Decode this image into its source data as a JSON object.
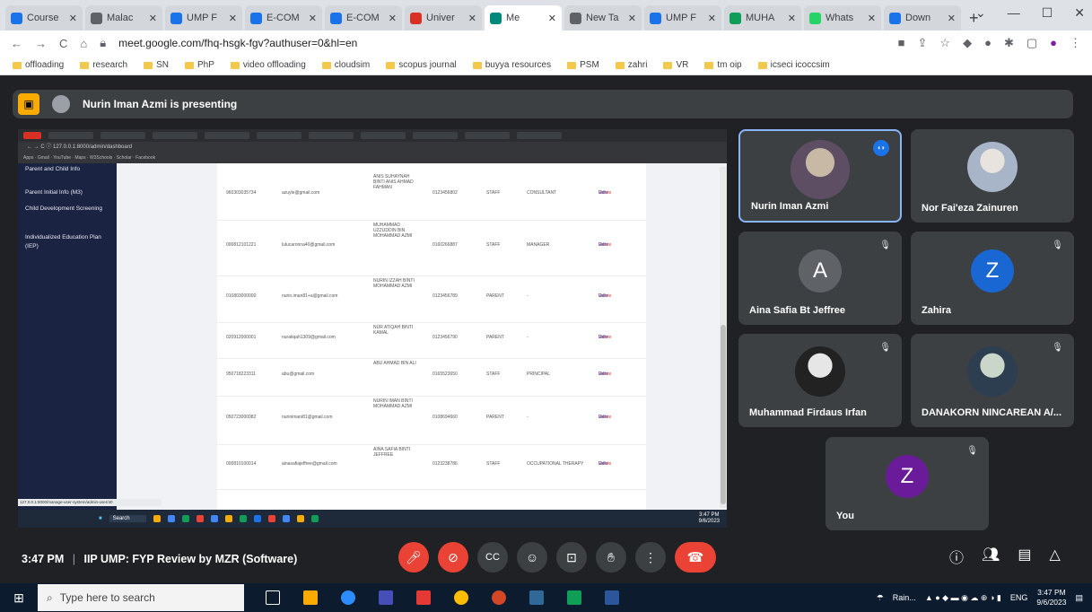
{
  "browser": {
    "tabs": [
      {
        "label": "Course",
        "icon": "ump-icon",
        "color": "#1a73e8"
      },
      {
        "label": "Malac",
        "icon": "chrome-icon",
        "color": "#5f6368"
      },
      {
        "label": "UMP F",
        "icon": "ump-icon",
        "color": "#1a73e8"
      },
      {
        "label": "E-COM",
        "icon": "ump-icon",
        "color": "#1a73e8"
      },
      {
        "label": "E-COM",
        "icon": "ump-icon",
        "color": "#1a73e8"
      },
      {
        "label": "Univer",
        "icon": "gmail-icon",
        "color": "#d93025"
      },
      {
        "label": "Me",
        "icon": "meet-icon",
        "color": "#00897b",
        "active": true
      },
      {
        "label": "New Ta",
        "icon": "chrome-icon",
        "color": "#5f6368"
      },
      {
        "label": "UMP F",
        "icon": "ump-icon",
        "color": "#1a73e8"
      },
      {
        "label": "MUHA",
        "icon": "drive-icon",
        "color": "#0f9d58"
      },
      {
        "label": "Whats",
        "icon": "whatsapp-icon",
        "color": "#25d366"
      },
      {
        "label": "Down",
        "icon": "download-icon",
        "color": "#1a73e8"
      }
    ],
    "new_tab": "+",
    "url": "meet.google.com/fhq-hsgk-fgv?authuser=0&hl=en",
    "bookmarks": [
      "offloading",
      "research",
      "SN",
      "PhP",
      "video offloading",
      "cloudsim",
      "scopus journal",
      "buyya resources",
      "PSM",
      "zahri",
      "VR",
      "tm oip",
      "icseci icoccsim"
    ]
  },
  "meet": {
    "presenting_text": "Nurin Iman Azmi is presenting",
    "time": "3:47 PM",
    "divider": "|",
    "meeting_title": "IIP UMP: FYP Review by MZR (Software)"
  },
  "shared_screen": {
    "sidebar": [
      "Parent and Child Info",
      "Parent Initial Info (M3)",
      "Child Development Screening",
      "Individualized Education Plan (IEP)"
    ],
    "status_url": "127.0.0.1:8000/manage-user-system/admin-user/40",
    "rows": [
      {
        "id": "960303035734",
        "email": "azuyle@gmail.com",
        "name": "ANIS SUHAYNAH BINTI ANIS AHMAD FAHMAN",
        "phone": "0123456802",
        "role": "STAFF",
        "position": "CONSULTANT"
      },
      {
        "id": "000812101221",
        "email": "lulucaronna40@gmail.com",
        "name": "MUHAMMAD UZZUDDIN BIN MOHAMMAD AZMI",
        "phone": "0160266887",
        "role": "STAFF",
        "position": "MANAGER"
      },
      {
        "id": "010803000000",
        "email": "nurin.iman81+a@gmail.com",
        "name": "NURIN IZZAH BINTI MOHAMMAD AZMI",
        "phone": "0123456789",
        "role": "PARENT",
        "position": "-"
      },
      {
        "id": "020912000001",
        "email": "nuratiqah1309@gmail.com",
        "name": "NUR ATIQAH BINTI KAMAL",
        "phone": "0123456790",
        "role": "PARENT",
        "position": "-"
      },
      {
        "id": "950718223311",
        "email": "abu@gmail.com",
        "name": "ABU AHMAD BIN ALI",
        "phone": "0165523650",
        "role": "STAFF",
        "position": "PRINCIPAL"
      },
      {
        "id": "050723000082",
        "email": "nurinimani81@gmail.com",
        "name": "NURIN IMAN BINTI MOHAMMAD AZMI",
        "phone": "0108694660",
        "role": "PARENT",
        "position": "-"
      },
      {
        "id": "000810100014",
        "email": "ainasafiajeffree@gmail.com",
        "name": "AINA SAFIA BINTI JEFFREE",
        "phone": "0123238786",
        "role": "STAFF",
        "position": "OCCUPATIONAL THERAPY"
      }
    ],
    "view_label": "View",
    "edit_label": "Edit",
    "delete_label": "Delete",
    "taskbar_search": "Search",
    "taskbar_time": "3:47 PM",
    "taskbar_date": "9/6/2023"
  },
  "participants": [
    {
      "name": "Nurin Iman Azmi",
      "speaking": true,
      "avatar": "photo"
    },
    {
      "name": "Nor Fai'eza Zainuren",
      "avatar": "photo"
    },
    {
      "name": "Aina Safia Bt Jeffree",
      "letter": "A",
      "color": "#5f6368",
      "muted": true
    },
    {
      "name": "Zahira",
      "letter": "Z",
      "color": "#1967d2",
      "muted": true
    },
    {
      "name": "Muhammad Firdaus Irfan",
      "avatar": "photo",
      "muted": true
    },
    {
      "name": "DANAKORN NINCAREAN A/...",
      "avatar": "photo",
      "muted": true
    },
    {
      "name": "You",
      "letter": "Z",
      "color": "#6a1b9a",
      "muted": true
    }
  ],
  "taskbar": {
    "search_placeholder": "Type here to search",
    "weather": "Rain...",
    "lang": "ENG",
    "time": "3:47 PM",
    "date": "9/6/2023"
  }
}
